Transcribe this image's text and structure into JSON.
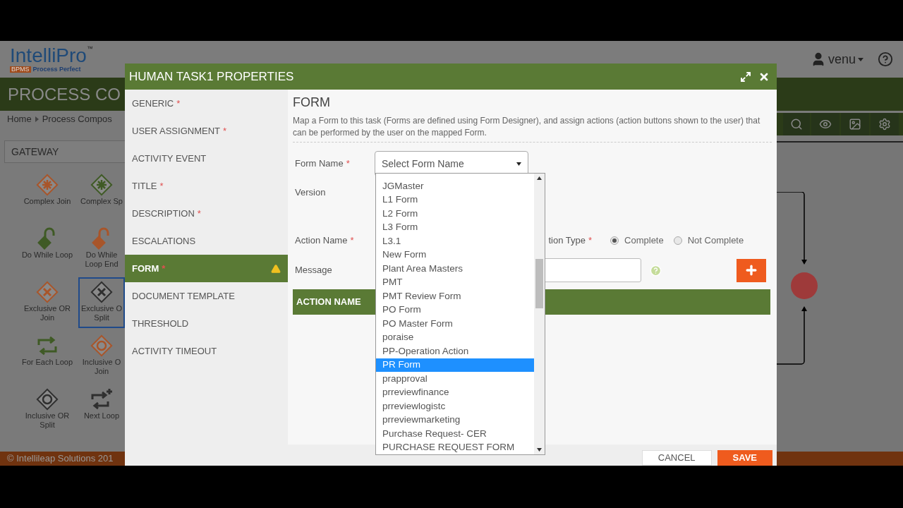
{
  "app": {
    "logo": {
      "name": "IntelliPro",
      "tm": "™",
      "badge": "BPMS",
      "tagline": "Process Perfect"
    },
    "user": "venu",
    "title": "PROCESS CO",
    "breadcrumb": [
      "Home",
      "Process Compos"
    ],
    "palette": {
      "heading": "GATEWAY",
      "items": [
        {
          "label": "Complex Join",
          "kind": "complex",
          "color": "#a8552a",
          "selected": false
        },
        {
          "label": "Complex Sp",
          "kind": "complex",
          "color": "#3f5a25",
          "selected": false
        },
        {
          "label": "Do While Loop",
          "kind": "lock",
          "color": "#3f5a25",
          "selected": false
        },
        {
          "label": "Do While Loop End",
          "kind": "lock",
          "color": "#a8552a",
          "selected": false
        },
        {
          "label": "Exclusive OR Join",
          "kind": "exclusive",
          "color": "#a8552a",
          "selected": false
        },
        {
          "label": "Exclusive O Split",
          "kind": "exclusive",
          "color": "#2f2f2f",
          "selected": true
        },
        {
          "label": "For Each Loop",
          "kind": "loop",
          "color": "#3f5a25",
          "selected": false
        },
        {
          "label": "Inclusive O Join",
          "kind": "inclusive",
          "color": "#a8552a",
          "selected": false
        },
        {
          "label": "Inclusive OR Split",
          "kind": "inclusive",
          "color": "#2f2f2f",
          "selected": false
        },
        {
          "label": "Next Loop",
          "kind": "next",
          "color": "#2f2f2f",
          "selected": false
        }
      ]
    },
    "footer": "© Intellileap Solutions 201"
  },
  "dialog": {
    "title": "HUMAN TASK1 PROPERTIES",
    "required_mark": "*",
    "sections": [
      {
        "label": "GENERIC",
        "required": true,
        "selected": false,
        "warning": false
      },
      {
        "label": "USER ASSIGNMENT",
        "required": true,
        "selected": false,
        "warning": false
      },
      {
        "label": "ACTIVITY EVENT",
        "required": false,
        "selected": false,
        "warning": false
      },
      {
        "label": "TITLE",
        "required": true,
        "selected": false,
        "warning": false
      },
      {
        "label": "DESCRIPTION",
        "required": true,
        "selected": false,
        "warning": false
      },
      {
        "label": "ESCALATIONS",
        "required": false,
        "selected": false,
        "warning": false
      },
      {
        "label": "FORM",
        "required": true,
        "selected": true,
        "warning": true
      },
      {
        "label": "DOCUMENT TEMPLATE",
        "required": false,
        "selected": false,
        "warning": false
      },
      {
        "label": "THRESHOLD",
        "required": false,
        "selected": false,
        "warning": false
      },
      {
        "label": "ACTIVITY TIMEOUT",
        "required": false,
        "selected": false,
        "warning": false
      }
    ],
    "heading": "FORM",
    "description": "Map a Form to this task (Forms are defined using Form Designer), and assign actions (action buttons shown to the user) that can be performed by the user on the mapped Form.",
    "form_name": {
      "label": "Form Name",
      "placeholder": "Select Form Name"
    },
    "version_label": "Version",
    "action_name_label": "Action Name",
    "action_type": {
      "label": "tion Type",
      "options": [
        {
          "label": "Complete",
          "selected": true
        },
        {
          "label": "Not Complete",
          "selected": false
        }
      ]
    },
    "message_label": "Message",
    "table": {
      "columns": [
        "ACTION NAME"
      ]
    },
    "dropdown": [
      {
        "label": "JGMaster",
        "selected": false
      },
      {
        "label": "L1 Form",
        "selected": false
      },
      {
        "label": "L2 Form",
        "selected": false
      },
      {
        "label": "L3 Form",
        "selected": false
      },
      {
        "label": "L3.1",
        "selected": false
      },
      {
        "label": "New Form",
        "selected": false
      },
      {
        "label": "Plant Area Masters",
        "selected": false
      },
      {
        "label": "PMT",
        "selected": false
      },
      {
        "label": "PMT Review Form",
        "selected": false
      },
      {
        "label": "PO Form",
        "selected": false
      },
      {
        "label": "PO Master Form",
        "selected": false
      },
      {
        "label": "poraise",
        "selected": false
      },
      {
        "label": "PP-Operation Action",
        "selected": false
      },
      {
        "label": "PR Form",
        "selected": true
      },
      {
        "label": "prapproval",
        "selected": false
      },
      {
        "label": "prreviewfinance",
        "selected": false
      },
      {
        "label": "prreviewlogistc",
        "selected": false
      },
      {
        "label": "prreviewmarketing",
        "selected": false
      },
      {
        "label": "Purchase Request- CER",
        "selected": false
      },
      {
        "label": "PURCHASE REQUEST FORM",
        "selected": false
      }
    ],
    "buttons": [
      "CANCEL",
      "SAVE"
    ]
  }
}
